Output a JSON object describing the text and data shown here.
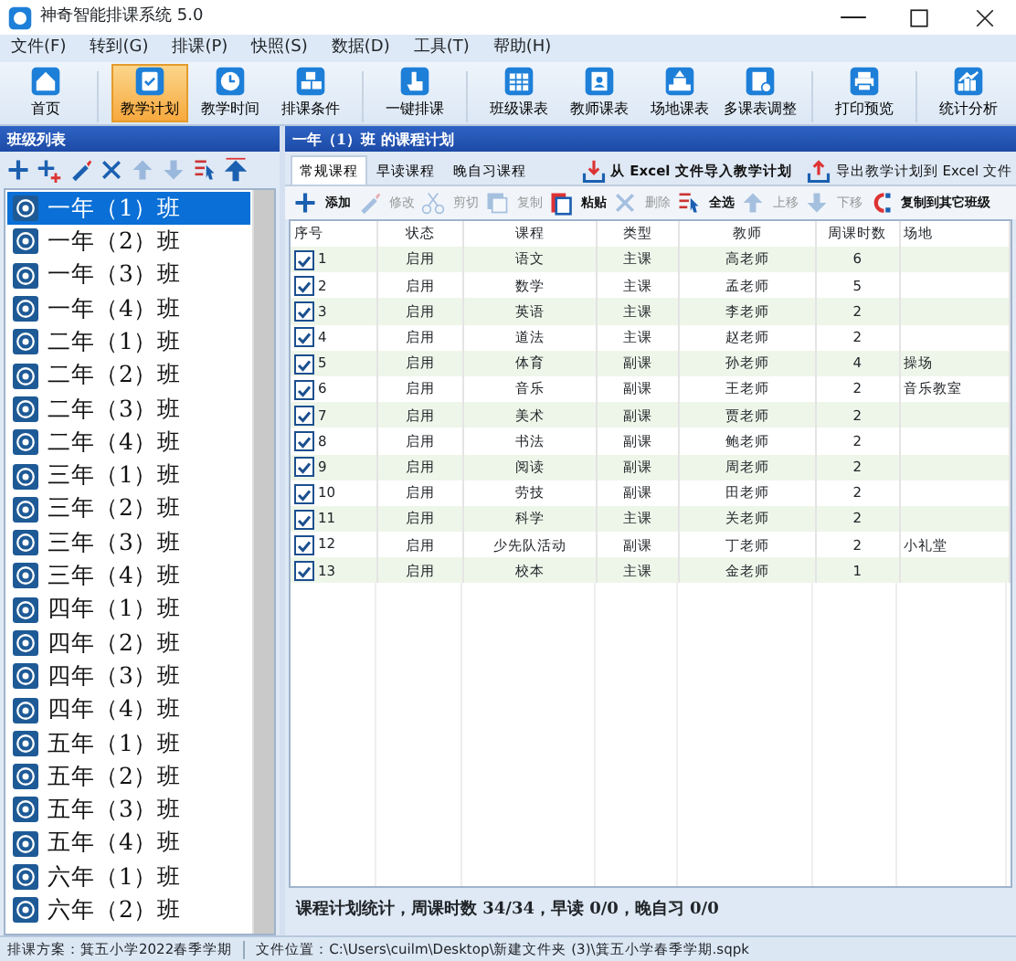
{
  "window": {
    "title": "神奇智能排课系统 5.0"
  },
  "menu": [
    "文件(F)",
    "转到(G)",
    "排课(P)",
    "快照(S)",
    "数据(D)",
    "工具(T)",
    "帮助(H)"
  ],
  "toolbar": [
    {
      "label": "首页",
      "kind": "home",
      "selected": false
    },
    {
      "label": "教学计划",
      "kind": "clipboard",
      "selected": true
    },
    {
      "label": "教学时间",
      "kind": "clock",
      "selected": false
    },
    {
      "label": "排课条件",
      "kind": "cubes",
      "selected": false
    },
    {
      "label": "一键排课",
      "kind": "hand",
      "selected": false
    },
    {
      "label": "班级课表",
      "kind": "calendar",
      "selected": false
    },
    {
      "label": "教师课表",
      "kind": "person",
      "selected": false
    },
    {
      "label": "场地课表",
      "kind": "building",
      "selected": false
    },
    {
      "label": "多课表调整",
      "kind": "doc",
      "selected": false
    },
    {
      "label": "打印预览",
      "kind": "printer",
      "selected": false
    },
    {
      "label": "统计分析",
      "kind": "chart",
      "selected": false
    }
  ],
  "class_panel": {
    "title": "班级列表",
    "tools": [
      {
        "kind": "add",
        "disabled": false
      },
      {
        "kind": "add-sub",
        "disabled": false
      },
      {
        "kind": "edit",
        "disabled": false
      },
      {
        "kind": "delete",
        "disabled": false
      },
      {
        "kind": "up",
        "disabled": true
      },
      {
        "kind": "down",
        "disabled": true
      },
      {
        "kind": "select",
        "disabled": false
      },
      {
        "kind": "top",
        "disabled": false
      }
    ],
    "classes": [
      {
        "label": "一年（1）班",
        "selected": true
      },
      {
        "label": "一年（2）班",
        "selected": false
      },
      {
        "label": "一年（3）班",
        "selected": false
      },
      {
        "label": "一年（4）班",
        "selected": false
      },
      {
        "label": "二年（1）班",
        "selected": false
      },
      {
        "label": "二年（2）班",
        "selected": false
      },
      {
        "label": "二年（3）班",
        "selected": false
      },
      {
        "label": "二年（4）班",
        "selected": false
      },
      {
        "label": "三年（1）班",
        "selected": false
      },
      {
        "label": "三年（2）班",
        "selected": false
      },
      {
        "label": "三年（3）班",
        "selected": false
      },
      {
        "label": "三年（4）班",
        "selected": false
      },
      {
        "label": "四年（1）班",
        "selected": false
      },
      {
        "label": "四年（2）班",
        "selected": false
      },
      {
        "label": "四年（3）班",
        "selected": false
      },
      {
        "label": "四年（4）班",
        "selected": false
      },
      {
        "label": "五年（1）班",
        "selected": false
      },
      {
        "label": "五年（2）班",
        "selected": false
      },
      {
        "label": "五年（3）班",
        "selected": false
      },
      {
        "label": "五年（4）班",
        "selected": false
      },
      {
        "label": "六年（1）班",
        "selected": false
      },
      {
        "label": "六年（2）班",
        "selected": false
      }
    ]
  },
  "plan_panel": {
    "title": "一年（1）班 的课程计划",
    "tabs": [
      {
        "label": "常规课程",
        "selected": true
      },
      {
        "label": "早读课程",
        "selected": false
      },
      {
        "label": "晚自习课程",
        "selected": false
      }
    ],
    "links": [
      {
        "label": "从 Excel 文件导入教学计划",
        "kind": "import"
      },
      {
        "label": "导出教学计划到 Excel 文件",
        "kind": "export"
      }
    ],
    "actions": [
      {
        "label": "添加",
        "kind": "add",
        "disabled": false
      },
      {
        "label": "修改",
        "kind": "edit",
        "disabled": true
      },
      {
        "label": "剪切",
        "kind": "cut",
        "disabled": true
      },
      {
        "label": "复制",
        "kind": "copy",
        "disabled": true
      },
      {
        "label": "粘贴",
        "kind": "paste",
        "disabled": false
      },
      {
        "label": "删除",
        "kind": "delete",
        "disabled": true
      },
      {
        "label": "全选",
        "kind": "select",
        "disabled": false
      },
      {
        "label": "上移",
        "kind": "up",
        "disabled": true
      },
      {
        "label": "下移",
        "kind": "down",
        "disabled": true
      },
      {
        "label": "复制到其它班级",
        "kind": "share",
        "disabled": false
      }
    ],
    "columns": [
      "序号",
      "状态",
      "课程",
      "类型",
      "教师",
      "周课时数",
      "场地"
    ],
    "rows": [
      {
        "checked": true,
        "cells": [
          "1",
          "启用",
          "语文",
          "主课",
          "高老师",
          "6",
          ""
        ]
      },
      {
        "checked": true,
        "cells": [
          "2",
          "启用",
          "数学",
          "主课",
          "孟老师",
          "5",
          ""
        ]
      },
      {
        "checked": true,
        "cells": [
          "3",
          "启用",
          "英语",
          "主课",
          "李老师",
          "2",
          ""
        ]
      },
      {
        "checked": true,
        "cells": [
          "4",
          "启用",
          "道法",
          "主课",
          "赵老师",
          "2",
          ""
        ]
      },
      {
        "checked": true,
        "cells": [
          "5",
          "启用",
          "体育",
          "副课",
          "孙老师",
          "4",
          "操场"
        ]
      },
      {
        "checked": true,
        "cells": [
          "6",
          "启用",
          "音乐",
          "副课",
          "王老师",
          "2",
          "音乐教室"
        ]
      },
      {
        "checked": true,
        "cells": [
          "7",
          "启用",
          "美术",
          "副课",
          "贾老师",
          "2",
          ""
        ]
      },
      {
        "checked": true,
        "cells": [
          "8",
          "启用",
          "书法",
          "副课",
          "鲍老师",
          "2",
          ""
        ]
      },
      {
        "checked": true,
        "cells": [
          "9",
          "启用",
          "阅读",
          "副课",
          "周老师",
          "2",
          ""
        ]
      },
      {
        "checked": true,
        "cells": [
          "10",
          "启用",
          "劳技",
          "副课",
          "田老师",
          "2",
          ""
        ]
      },
      {
        "checked": true,
        "cells": [
          "11",
          "启用",
          "科学",
          "主课",
          "关老师",
          "2",
          ""
        ]
      },
      {
        "checked": true,
        "cells": [
          "12",
          "启用",
          "少先队活动",
          "副课",
          "丁老师",
          "2",
          "小礼堂"
        ]
      },
      {
        "checked": true,
        "cells": [
          "13",
          "启用",
          "校本",
          "主课",
          "金老师",
          "1",
          ""
        ]
      }
    ],
    "summary": "课程计划统计，周课时数 34/34，早读 0/0，晚自习 0/0"
  },
  "status_bar": [
    "排课方案：箕五小学2022春季学期",
    "文件位置：C:\\Users\\cuilm\\Desktop\\新建文件夹 (3)\\箕五小学春季学期.sqpk"
  ]
}
